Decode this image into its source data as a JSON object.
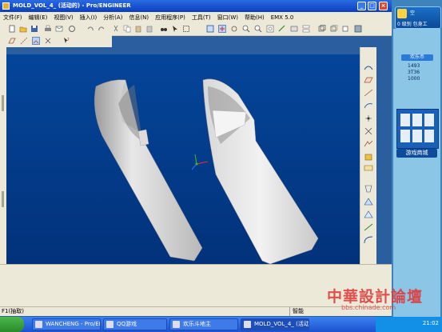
{
  "window": {
    "title": "MOLD_VOL_4_ (活动的) - Pro/ENGINEER",
    "minimize": "_",
    "maximize": "□",
    "close": "×"
  },
  "menu": [
    "文件(F)",
    "编辑(E)",
    "视图(V)",
    "插入(I)",
    "分析(A)",
    "信息(N)",
    "应用程序(P)",
    "工具(T)",
    "窗口(W)",
    "帮助(H)",
    "EMX 5.0"
  ],
  "status": {
    "message": "F1(抽取)",
    "filter": "智能"
  },
  "side_panel": {
    "head_label": "空",
    "head_detail": "0 级别  包身工",
    "rank_tab": "欢乐币",
    "stats": [
      "1493",
      "3T36",
      "1000"
    ],
    "game_mall": "游戏商城"
  },
  "taskbar": {
    "items": [
      "WANCHENG - Pro/ENG...",
      "QQ游戏",
      "欢乐斗地主",
      "MOLD_VOL_4_ (活动..."
    ],
    "clock": "21:02"
  },
  "watermark": {
    "main": "中華設計論壇",
    "url": "bbs.chinade.com"
  },
  "colors": {
    "viewport_top": "#04459a",
    "viewport_bottom": "#02327a",
    "part": "#e4e4e4"
  }
}
